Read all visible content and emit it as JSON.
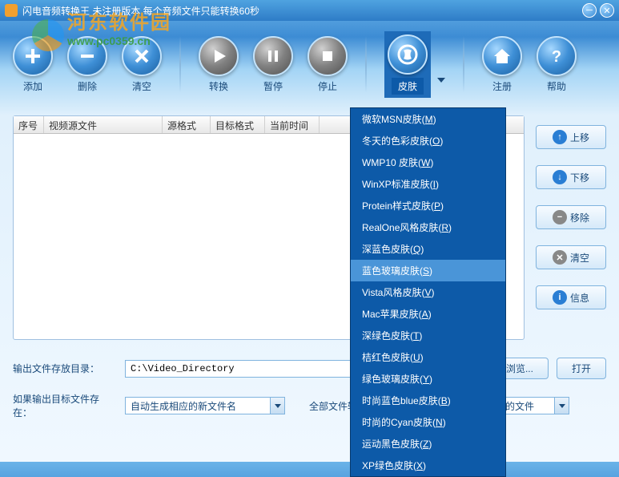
{
  "window": {
    "title": "闪电音频转换王 未注册版本 每个音频文件只能转换60秒"
  },
  "watermark": {
    "name": "河东软件园",
    "url": "www.pc0359.cn"
  },
  "toolbar": {
    "add": "添加",
    "delete": "删除",
    "clear": "清空",
    "convert": "转换",
    "pause": "暂停",
    "stop": "停止",
    "skin": "皮肤",
    "register": "注册",
    "help": "帮助"
  },
  "skin_menu": [
    {
      "label": "微软MSN皮肤",
      "key": "M"
    },
    {
      "label": "冬天的色彩皮肤",
      "key": "O"
    },
    {
      "label": "WMP10 皮肤",
      "key": "W"
    },
    {
      "label": "WinXP标准皮肤",
      "key": "I"
    },
    {
      "label": "Protein样式皮肤",
      "key": "P"
    },
    {
      "label": "RealOne风格皮肤",
      "key": "R"
    },
    {
      "label": "深蓝色皮肤",
      "key": "Q"
    },
    {
      "label": "蓝色玻璃皮肤",
      "key": "S",
      "selected": true
    },
    {
      "label": "Vista风格皮肤",
      "key": "V"
    },
    {
      "label": "Mac苹果皮肤",
      "key": "A"
    },
    {
      "label": "深绿色皮肤",
      "key": "T"
    },
    {
      "label": "桔红色皮肤",
      "key": "U"
    },
    {
      "label": "绿色玻璃皮肤",
      "key": "Y"
    },
    {
      "label": "时尚蓝色blue皮肤",
      "key": "B"
    },
    {
      "label": "时尚的Cyan皮肤",
      "key": "N"
    },
    {
      "label": "运动黑色皮肤",
      "key": "Z"
    },
    {
      "label": "XP绿色皮肤",
      "key": "X"
    }
  ],
  "columns": {
    "c1": "序号",
    "c2": "视频源文件",
    "c3": "源格式",
    "c4": "目标格式",
    "c5": "当前时间"
  },
  "side": {
    "up": "上移",
    "down": "下移",
    "remove": "移除",
    "clear": "清空",
    "info": "信息"
  },
  "bottom": {
    "output_label": "输出文件存放目录：",
    "output_path": "C:\\Video_Directory",
    "browse": "浏览...",
    "open": "打开",
    "exists_label": "如果输出目标文件存在：",
    "exists_value": "自动生成相应的新文件名",
    "after_label": "全部文件转换完毕后：",
    "after_value": "打开文件夹查看转换的文件"
  }
}
